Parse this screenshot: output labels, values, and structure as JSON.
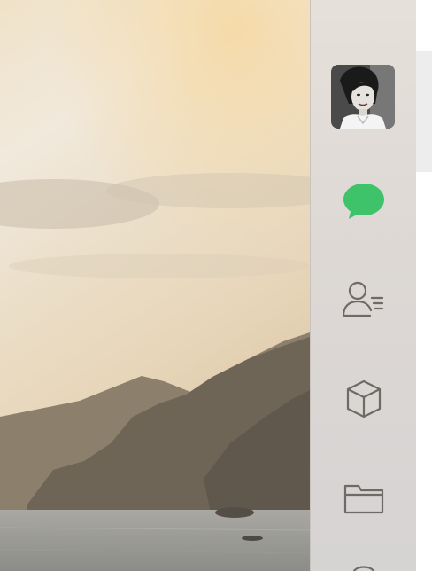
{
  "user": {
    "avatar_icon": "user-portrait"
  },
  "sidebar": {
    "items": [
      {
        "icon": "chat-bubble-icon",
        "active": true,
        "color": "#3ec26a"
      },
      {
        "icon": "contacts-icon",
        "active": false,
        "color": "#6e6a66"
      },
      {
        "icon": "cube-icon",
        "active": false,
        "color": "#6e6a66"
      },
      {
        "icon": "folder-icon",
        "active": false,
        "color": "#6e6a66"
      },
      {
        "icon": "more-icon",
        "active": false,
        "color": "#6e6a66"
      }
    ]
  },
  "colors": {
    "accent": "#3ec26a",
    "sidebar_bg": "#e0dbd6",
    "icon_gray": "#6e6a66"
  }
}
